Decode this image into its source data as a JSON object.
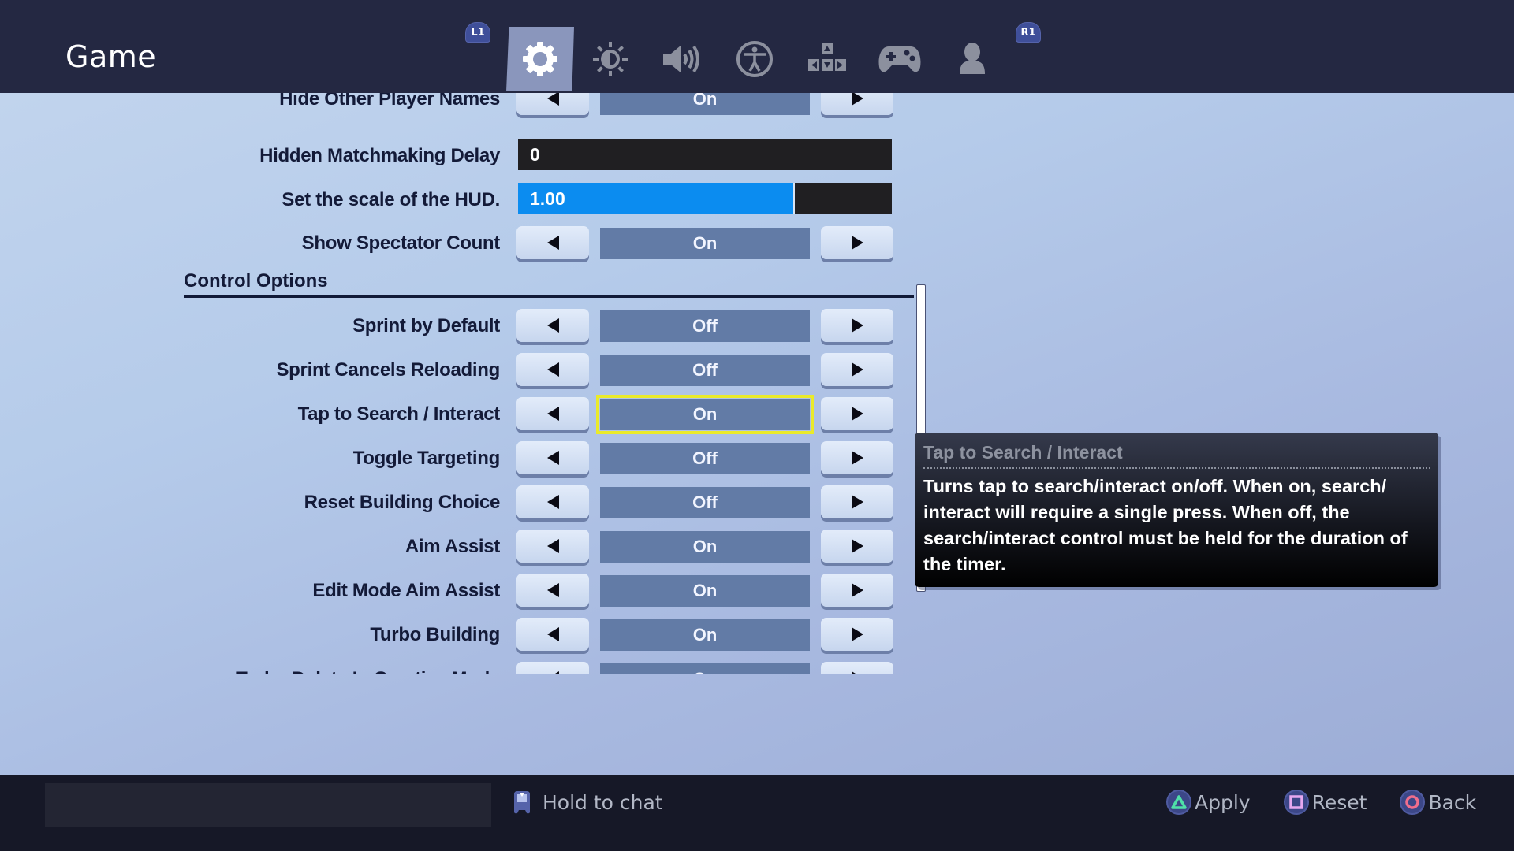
{
  "header": {
    "title": "Game",
    "left_bumper": "L1",
    "right_bumper": "R1",
    "tabs": [
      {
        "icon": "gear-icon",
        "label": "Game",
        "active": true
      },
      {
        "icon": "brightness-icon",
        "label": "Video",
        "active": false
      },
      {
        "icon": "speaker-icon",
        "label": "Audio",
        "active": false
      },
      {
        "icon": "accessibility-icon",
        "label": "Accessibility",
        "active": false
      },
      {
        "icon": "dpad-icon",
        "label": "Input",
        "active": false
      },
      {
        "icon": "gamepad-icon",
        "label": "Controller",
        "active": false
      },
      {
        "icon": "account-icon",
        "label": "Account",
        "active": false
      }
    ]
  },
  "settings": {
    "partial_top": {
      "label": "Hide Other Player Names",
      "value": "On"
    },
    "hidden_matchmaking_delay": {
      "label": "Hidden Matchmaking Delay",
      "value": "0"
    },
    "hud_scale": {
      "label": "Set the scale of the HUD.",
      "value": "1.00",
      "fill_fraction": 0.74
    },
    "show_spectator_count": {
      "label": "Show Spectator Count",
      "value": "On"
    },
    "section_title": "Control Options",
    "control_options": [
      {
        "label": "Sprint by Default",
        "value": "Off",
        "selected": false
      },
      {
        "label": "Sprint Cancels Reloading",
        "value": "Off",
        "selected": false
      },
      {
        "label": "Tap to Search / Interact",
        "value": "On",
        "selected": true
      },
      {
        "label": "Toggle Targeting",
        "value": "Off",
        "selected": false
      },
      {
        "label": "Reset Building Choice",
        "value": "Off",
        "selected": false
      },
      {
        "label": "Aim Assist",
        "value": "On",
        "selected": false
      },
      {
        "label": "Edit Mode Aim Assist",
        "value": "On",
        "selected": false
      },
      {
        "label": "Turbo Building",
        "value": "On",
        "selected": false
      }
    ],
    "partial_bottom": {
      "label": "Turbo Delete In Creative Mode",
      "value": "On"
    }
  },
  "tooltip": {
    "title": "Tap to Search / Interact",
    "body": "Turns tap to search/interact on/off. When on, search/ interact will require a single press. When off, the search/interact control must be held for the duration of the timer."
  },
  "footer": {
    "chat_hint": "Hold to chat",
    "actions": [
      {
        "label": "Apply",
        "icon": "triangle-button-icon",
        "color": "#4fe0a8"
      },
      {
        "label": "Reset",
        "icon": "square-button-icon",
        "color": "#e6a8f0"
      },
      {
        "label": "Back",
        "icon": "circle-button-icon",
        "color": "#f06e8c"
      }
    ]
  },
  "colors": {
    "header_bg": "#242842",
    "footer_bg": "#161827",
    "value_bg": "#627ba6",
    "selected_outline": "#eaea2a",
    "slider_fill": "#0b8cf0"
  }
}
